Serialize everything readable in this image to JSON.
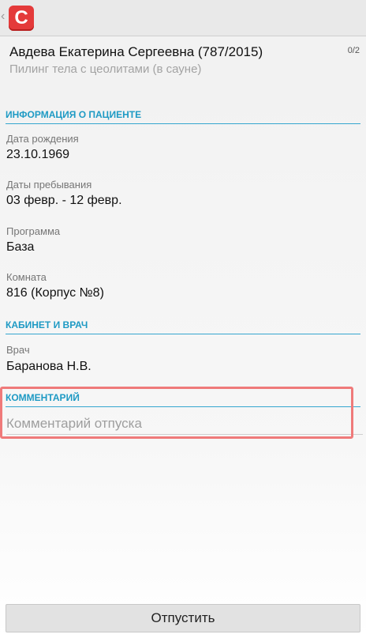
{
  "header": {
    "back_glyph": "‹",
    "logo_letter": "C",
    "logo_color": "#e43a3a"
  },
  "patient": {
    "name": "Авдева Екатерина Сергеевна (787/2015)",
    "procedure": "Пилинг тела с цеолитами (в сауне)",
    "counter": "0/2"
  },
  "sections": {
    "patient_info": {
      "title": "ИНФОРМАЦИЯ О ПАЦИЕНТЕ",
      "fields": [
        {
          "label": "Дата рождения",
          "value": "23.10.1969"
        },
        {
          "label": "Даты пребывания",
          "value": "03 февр. - 12 февр."
        },
        {
          "label": "Программа",
          "value": "База"
        },
        {
          "label": "Комната",
          "value": "816 (Корпус №8)"
        }
      ]
    },
    "cabinet": {
      "title": "КАБИНЕТ И ВРАЧ",
      "fields": [
        {
          "label": "Врач",
          "value": "Баранова Н.В."
        }
      ]
    },
    "comment": {
      "title": "КОММЕНТАРИЙ",
      "placeholder": "Комментарий отпуска",
      "value": ""
    }
  },
  "actions": {
    "release_label": "Отпустить"
  },
  "colors": {
    "accent": "#1e9ac4",
    "highlight": "#ef7a7a"
  }
}
